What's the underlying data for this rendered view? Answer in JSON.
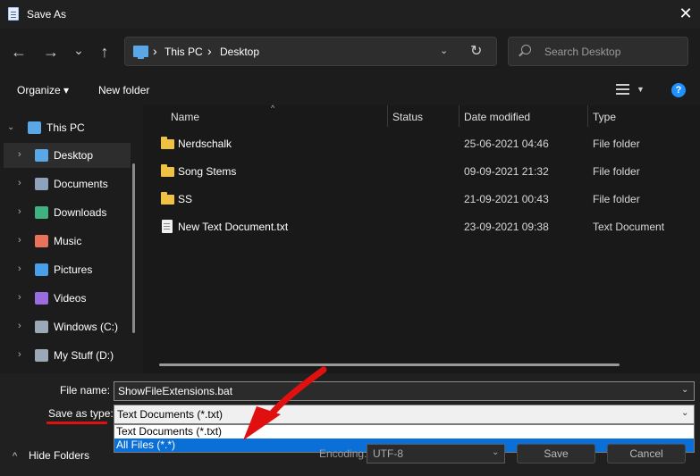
{
  "window": {
    "title": "Save As",
    "close_symbol": "✕"
  },
  "nav": {
    "back_symbol": "←",
    "forward_symbol": "→",
    "recent_symbol": "⌄",
    "up_symbol": "↑"
  },
  "address": {
    "segments": [
      "This PC",
      "Desktop"
    ],
    "separator": "›",
    "dropdown_symbol": "⌄",
    "refresh_symbol": "↻"
  },
  "search": {
    "placeholder": "Search Desktop"
  },
  "toolbar": {
    "organize_label": "Organize ▾",
    "new_folder_label": "New folder",
    "help_symbol": "?"
  },
  "nav_tree": {
    "root": {
      "label": "This PC",
      "icon": "pc-icon"
    },
    "items": [
      {
        "label": "Desktop",
        "icon": "desktop-icon",
        "color": "#5aa7e8",
        "selected": true
      },
      {
        "label": "Documents",
        "icon": "documents-icon",
        "color": "#8ea2bd",
        "selected": false
      },
      {
        "label": "Downloads",
        "icon": "downloads-icon",
        "color": "#3fb27f",
        "selected": false
      },
      {
        "label": "Music",
        "icon": "music-icon",
        "color": "#e8735a",
        "selected": false
      },
      {
        "label": "Pictures",
        "icon": "pictures-icon",
        "color": "#4aa0e8",
        "selected": false
      },
      {
        "label": "Videos",
        "icon": "videos-icon",
        "color": "#9b6be0",
        "selected": false
      },
      {
        "label": "Windows (C:)",
        "icon": "drive-c-icon",
        "color": "#9aa8b8",
        "selected": false
      },
      {
        "label": "My Stuff (D:)",
        "icon": "drive-d-icon",
        "color": "#9aa8b8",
        "selected": false
      }
    ]
  },
  "file_list": {
    "columns": [
      "Name",
      "Status",
      "Date modified",
      "Type"
    ],
    "sort_symbol": "^",
    "rows": [
      {
        "name": "Nerdschalk",
        "status": "",
        "date": "25-06-2021 04:46",
        "type": "File folder",
        "kind": "folder"
      },
      {
        "name": "Song Stems",
        "status": "",
        "date": "09-09-2021 21:32",
        "type": "File folder",
        "kind": "folder"
      },
      {
        "name": "SS",
        "status": "",
        "date": "21-09-2021 00:43",
        "type": "File folder",
        "kind": "folder"
      },
      {
        "name": "New Text Document.txt",
        "status": "",
        "date": "23-09-2021 09:38",
        "type": "Text Document",
        "kind": "file"
      }
    ]
  },
  "form": {
    "filename_label": "File name:",
    "filename_value": "ShowFileExtensions.bat",
    "type_label": "Save as type:",
    "type_value": "Text Documents (*.txt)",
    "type_options": [
      "Text Documents (*.txt)",
      "All Files  (*.*)"
    ],
    "highlighted_option": 1,
    "caret_symbol": "⌄",
    "encoding_label": "Encoding:",
    "encoding_value": "UTF-8",
    "hide_folders_label": "Hide Folders",
    "hide_folders_symbol": "^",
    "save_label": "Save",
    "cancel_label": "Cancel"
  },
  "colors": {
    "annotation_red": "#e01010",
    "highlight_blue": "#0a6fd6",
    "folder": "#f0c244"
  }
}
